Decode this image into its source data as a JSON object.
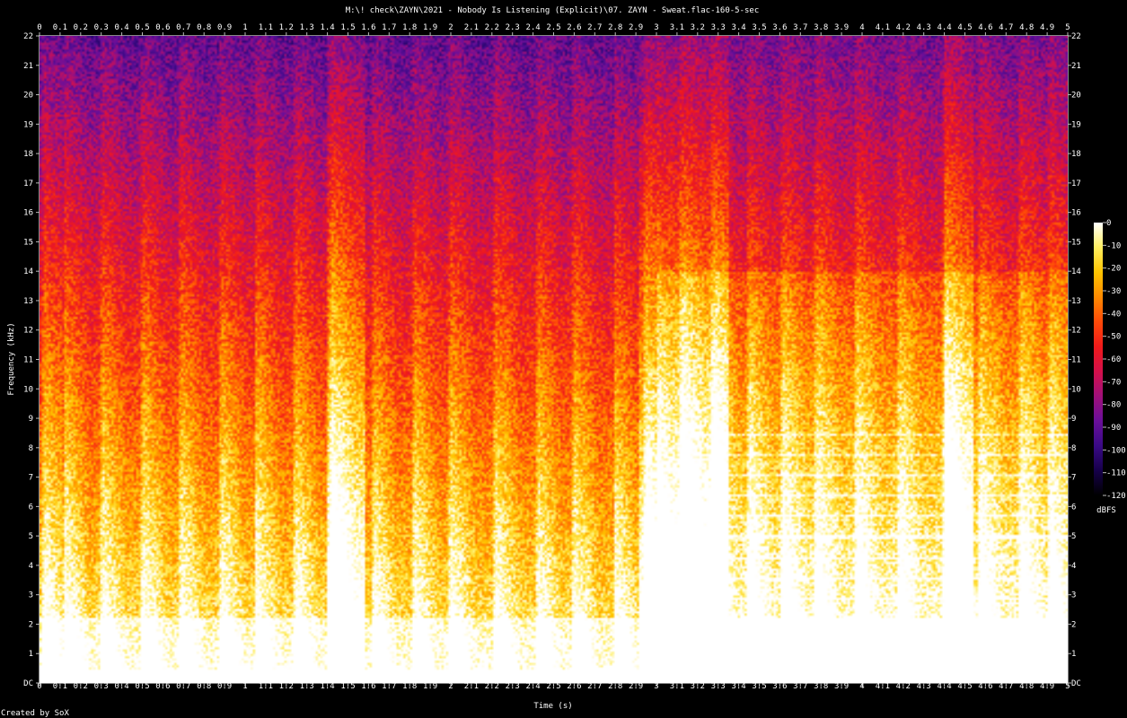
{
  "chart_data": {
    "type": "heatmap",
    "title": "M:\\! check\\ZAYN\\2021 - Nobody Is Listening (Explicit)\\07. ZAYN - Sweat.flac-160-5-sec",
    "xlabel": "Time (s)",
    "ylabel": "Frequency (kHz)",
    "x_ticks": [
      "0",
      "0.1",
      "0.2",
      "0.3",
      "0.4",
      "0.5",
      "0.6",
      "0.7",
      "0.8",
      "0.9",
      "1",
      "1.1",
      "1.2",
      "1.3",
      "1.4",
      "1.5",
      "1.6",
      "1.7",
      "1.8",
      "1.9",
      "2",
      "2.1",
      "2.2",
      "2.3",
      "2.4",
      "2.5",
      "2.6",
      "2.7",
      "2.8",
      "2.9",
      "3",
      "3.1",
      "3.2",
      "3.3",
      "3.4",
      "3.5",
      "3.6",
      "3.7",
      "3.8",
      "3.9",
      "4",
      "4.1",
      "4.2",
      "4.3",
      "4.4",
      "4.5",
      "4.6",
      "4.7",
      "4.8",
      "4.9",
      "5"
    ],
    "y_ticks": [
      "DC",
      "1",
      "2",
      "3",
      "4",
      "5",
      "6",
      "7",
      "8",
      "9",
      "10",
      "11",
      "12",
      "13",
      "14",
      "15",
      "16",
      "17",
      "18",
      "19",
      "20",
      "21",
      "22"
    ],
    "xlim": [
      0,
      5
    ],
    "ylim": [
      0,
      22
    ],
    "colorbar": {
      "label": "dBFS",
      "ticks": [
        "0",
        "-10",
        "-20",
        "-30",
        "-40",
        "-50",
        "-60",
        "-70",
        "-80",
        "-90",
        "-100",
        "-110",
        "-120"
      ],
      "range": [
        -120,
        0
      ],
      "colors": [
        "#000000",
        "#16004a",
        "#3a0a86",
        "#6a0f9a",
        "#a0107a",
        "#d4104a",
        "#f01a1a",
        "#ff4a08",
        "#ff8a00",
        "#ffc400",
        "#ffee60",
        "#ffffff"
      ]
    },
    "footer": "Created by SoX"
  }
}
